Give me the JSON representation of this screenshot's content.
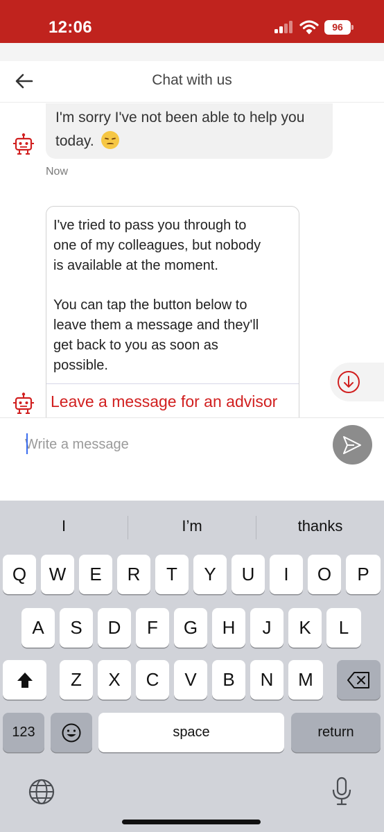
{
  "status_bar": {
    "time": "12:06",
    "battery": "96",
    "background_color": "#c0231e"
  },
  "header": {
    "title": "Chat with us",
    "back_icon": "arrow-left-icon"
  },
  "chat": {
    "bot_icon": "robot-icon",
    "messages": [
      {
        "text": "I'm sorry I've not been able to help you today.",
        "emoji": "pensive-face-emoji",
        "timestamp": "Now"
      },
      {
        "text": "I've tried to pass you through to\none of my colleagues, but nobody\nis available at the moment.\n\nYou can tap the button below to\nleave them a message and they'll\nget back to you as soon as\npossible.",
        "action_label": "Leave a message for an advisor"
      }
    ],
    "scroll_down_icon": "arrow-down-circle-icon",
    "accent_color": "#d11f1f"
  },
  "composer": {
    "placeholder": "Write a message",
    "value": "",
    "send_icon": "send-icon"
  },
  "keyboard": {
    "suggestions": [
      "I",
      "I’m",
      "thanks"
    ],
    "row1": [
      "Q",
      "W",
      "E",
      "R",
      "T",
      "Y",
      "U",
      "I",
      "O",
      "P"
    ],
    "row2": [
      "A",
      "S",
      "D",
      "F",
      "G",
      "H",
      "J",
      "K",
      "L"
    ],
    "row3": [
      "Z",
      "X",
      "C",
      "V",
      "B",
      "N",
      "M"
    ],
    "numbers_label": "123",
    "space_label": "space",
    "return_label": "return",
    "shift_icon": "shift-icon",
    "backspace_icon": "backspace-icon",
    "emoji_icon": "emoji-icon",
    "globe_icon": "globe-icon",
    "mic_icon": "microphone-icon"
  }
}
